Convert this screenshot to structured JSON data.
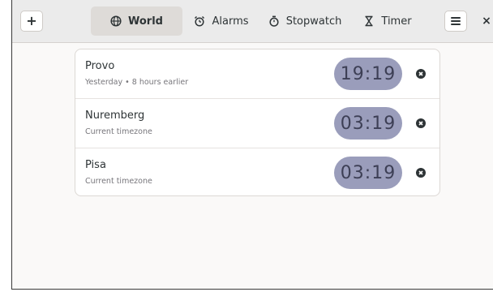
{
  "header": {
    "add_icon": "plus-icon",
    "menu_icon": "hamburger-menu-icon",
    "close_label": "×",
    "tabs": [
      {
        "label": "World",
        "icon": "globe-icon",
        "active": true
      },
      {
        "label": "Alarms",
        "icon": "alarm-clock-icon",
        "active": false
      },
      {
        "label": "Stopwatch",
        "icon": "stopwatch-icon",
        "active": false
      },
      {
        "label": "Timer",
        "icon": "hourglass-icon",
        "active": false
      }
    ]
  },
  "clocks": [
    {
      "city": "Provo",
      "subtitle": "Yesterday • 8 hours earlier",
      "time": "19:19"
    },
    {
      "city": "Nuremberg",
      "subtitle": "Current timezone",
      "time": "03:19"
    },
    {
      "city": "Pisa",
      "subtitle": "Current timezone",
      "time": "03:19"
    }
  ],
  "colors": {
    "time_pill_bg": "#9a9dbb",
    "time_pill_text": "#3d3f55",
    "window_bg": "#faf9f8",
    "header_bg": "#ebebeb"
  }
}
